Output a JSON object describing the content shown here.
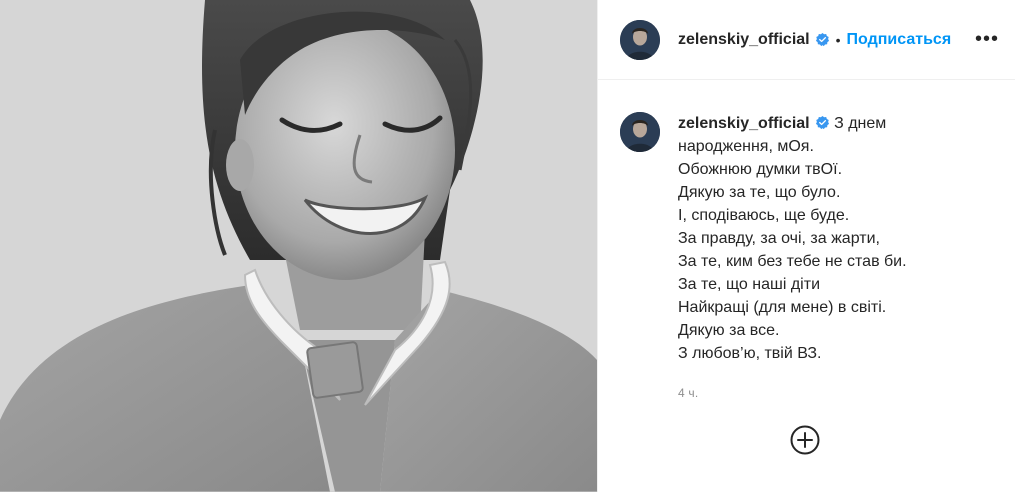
{
  "post": {
    "header": {
      "username": "zelenskiy_official",
      "separator": "•",
      "follow_label": "Подписаться",
      "more_label": "•••"
    },
    "caption": {
      "username": "zelenskiy_official",
      "lines": [
        "З днем",
        "народження, мОя.",
        "Обожнюю думки твОї.",
        "Дякую за те, що було.",
        "І, сподіваюсь, ще буде.",
        "За правду, за очі, за жарти,",
        "За те, ким без тебе не став би.",
        "За те, що наші діти",
        "Найкращі (для мене) в світі.",
        "Дякую за все.",
        "З любов’ю, твій ВЗ."
      ],
      "timestamp": "4 ч."
    },
    "icons": {
      "verified": "verified-badge-icon",
      "more": "more-options-icon",
      "add_comment": "add-comment-icon"
    },
    "colors": {
      "accent": "#0095f6",
      "text": "#262626",
      "muted": "#8e8e8e",
      "border": "#efefef"
    }
  }
}
